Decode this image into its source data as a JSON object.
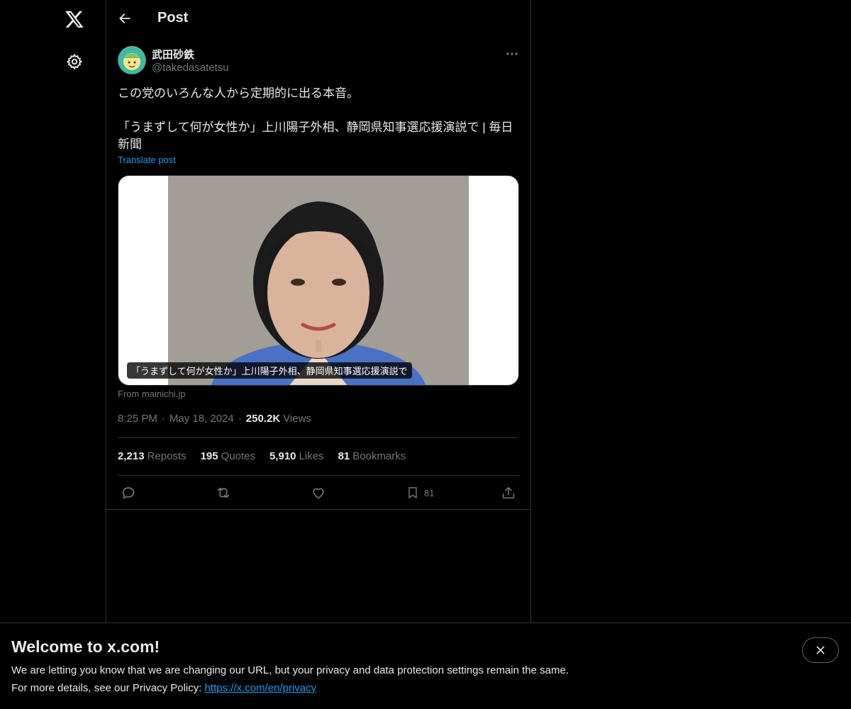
{
  "header": {
    "title": "Post"
  },
  "author": {
    "display_name": "武田砂鉄",
    "handle": "@takedasatetsu"
  },
  "post": {
    "text": "この党のいろんな人から定期的に出る本音。\n\n「うまずして何が女性か」上川陽子外相、静岡県知事選応援演説で | 毎日新聞",
    "translate_label": "Translate post",
    "card_caption": "「うまずして何が女性か」上川陽子外相、静岡県知事選応援演説で",
    "card_source": "From mainichi.jp",
    "time": "8:25 PM",
    "date": "May 18, 2024",
    "separator": "·",
    "views_count": "250.2K",
    "views_label": "Views"
  },
  "stats": {
    "reposts": {
      "count": "2,213",
      "label": "Reposts"
    },
    "quotes": {
      "count": "195",
      "label": "Quotes"
    },
    "likes": {
      "count": "5,910",
      "label": "Likes"
    },
    "bookmarks": {
      "count": "81",
      "label": "Bookmarks"
    }
  },
  "actions": {
    "bookmark_count": "81"
  },
  "banner": {
    "title": "Welcome to x.com!",
    "line1": "We are letting you know that we are changing our URL, but your privacy and data protection settings remain the same.",
    "line2_prefix": "For more details, see our Privacy Policy: ",
    "link": "https://x.com/en/privacy"
  },
  "icons": [
    "x-logo-icon",
    "gear-icon",
    "back-arrow-icon",
    "more-dots-icon",
    "reply-icon",
    "repost-icon",
    "like-icon",
    "bookmark-icon",
    "share-icon",
    "close-icon"
  ],
  "colors": {
    "background": "#000000",
    "text": "#e7e9ea",
    "secondary": "#71767b",
    "accent": "#1d9bf0",
    "border": "#2f3336"
  }
}
